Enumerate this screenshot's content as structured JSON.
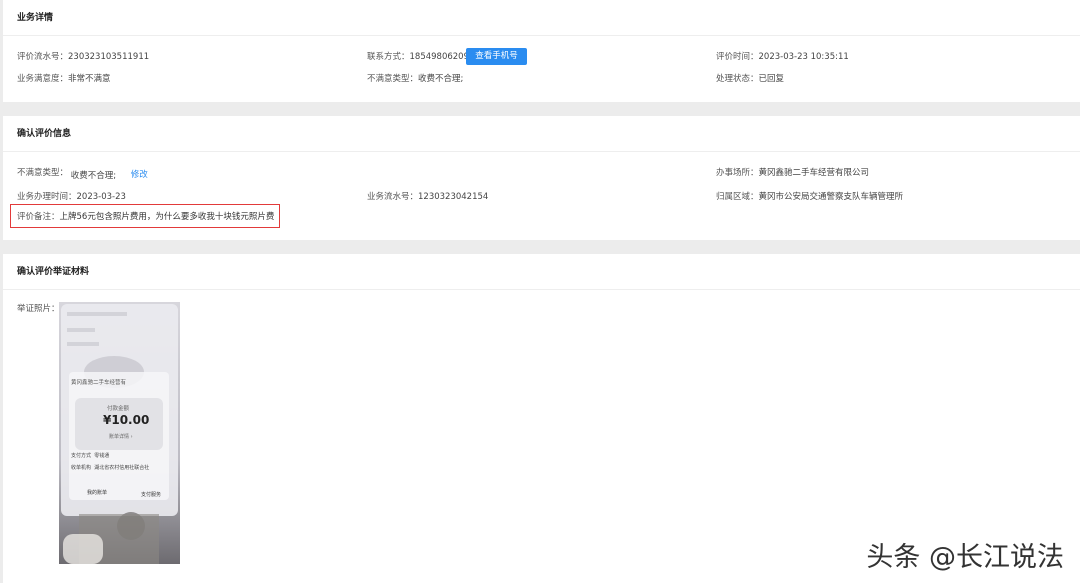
{
  "business": {
    "title": "业务详情",
    "serial_label": "评价流水号：",
    "serial_value": "230323103511911",
    "contact_label": "联系方式：",
    "contact_value": "18549806209",
    "view_phone_button": "查看手机号",
    "eval_time_label": "评价时间：",
    "eval_time_value": "2023-03-23 10:35:11",
    "satisfaction_label": "业务满意度：",
    "satisfaction_value": "非常不满意",
    "dissatisfaction_type_label": "不满意类型：",
    "dissatisfaction_type_value": "收费不合理;",
    "process_status_label": "处理状态：",
    "process_status_value": "已回复"
  },
  "confirm": {
    "title": "确认评价信息",
    "dissatisfaction_type_label": "不满意类型：",
    "dissatisfaction_type_value": "收费不合理;",
    "edit_link": "修改",
    "office_label": "办事场所：",
    "office_value": "黄冈鑫驰二手车经营有限公司",
    "handle_time_label": "业务办理时间：",
    "handle_time_value": "2023-03-23",
    "business_serial_label": "业务流水号：",
    "business_serial_value": "1230323042154",
    "region_label": "归属区域：",
    "region_value": "黄冈市公安局交通警察支队车辆管理所",
    "remark_label": "评价备注：",
    "remark_value": "上牌56元包含照片费用，为什么要多收我十块钱元照片费"
  },
  "evidence": {
    "title": "确认评价举证材料",
    "photo_label": "举证照片：",
    "photo": {
      "merchant": "黄冈鑫驰二手车经营有",
      "paid_label": "付款金额",
      "amount": "¥10.00",
      "detail": "账单详情 ›",
      "pay_method_label": "支付方式",
      "pay_method_value": "零钱通",
      "org_label": "收单机构",
      "org_value": "湖北省农村信用社联合社",
      "btn_left": "我的账单",
      "btn_right": "支付服务"
    }
  },
  "watermark": "头条 @长江说法",
  "colors": {
    "accent": "#2a8cf0",
    "highlight_border": "#e23a3a",
    "page_bg": "#ececec"
  }
}
